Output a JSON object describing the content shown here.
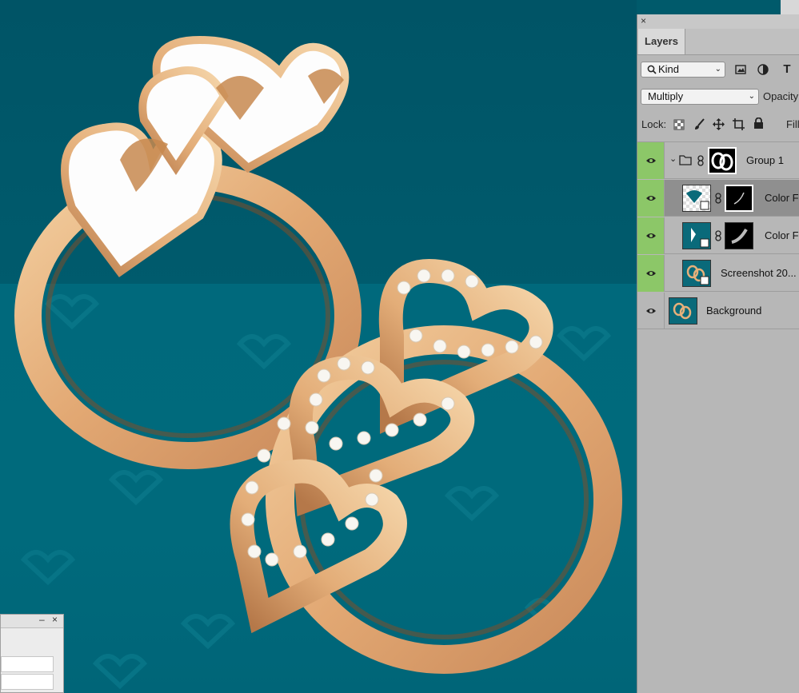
{
  "panel": {
    "close_glyph": "×",
    "tab_label": "Layers",
    "filter_kind": "Kind",
    "blend_mode": "Multiply",
    "opacity_label": "Opacity",
    "lock_label": "Lock:",
    "fill_label": "Fill"
  },
  "layers": [
    {
      "name": "Group 1",
      "visible": true,
      "selected": false,
      "eye_color": "#8cc768"
    },
    {
      "name": "Color F",
      "visible": true,
      "selected": true,
      "eye_color": "#8cc768"
    },
    {
      "name": "Color F",
      "visible": true,
      "selected": false,
      "eye_color": "#8cc768"
    },
    {
      "name": "Screenshot 20...",
      "visible": true,
      "selected": false,
      "eye_color": "#8cc768"
    },
    {
      "name": "Background",
      "visible": true,
      "selected": false,
      "eye_color": "#b7b7b7"
    }
  ],
  "dialog": {
    "minimize_glyph": "–",
    "close_glyph": "×"
  },
  "colors": {
    "canvas_wall": "#005466",
    "canvas_floor": "#006a7c",
    "gold": "#e6b07a",
    "panel_bg": "#b7b7b7",
    "selected_row": "#8f8f8f",
    "visible_green": "#8cc768"
  }
}
